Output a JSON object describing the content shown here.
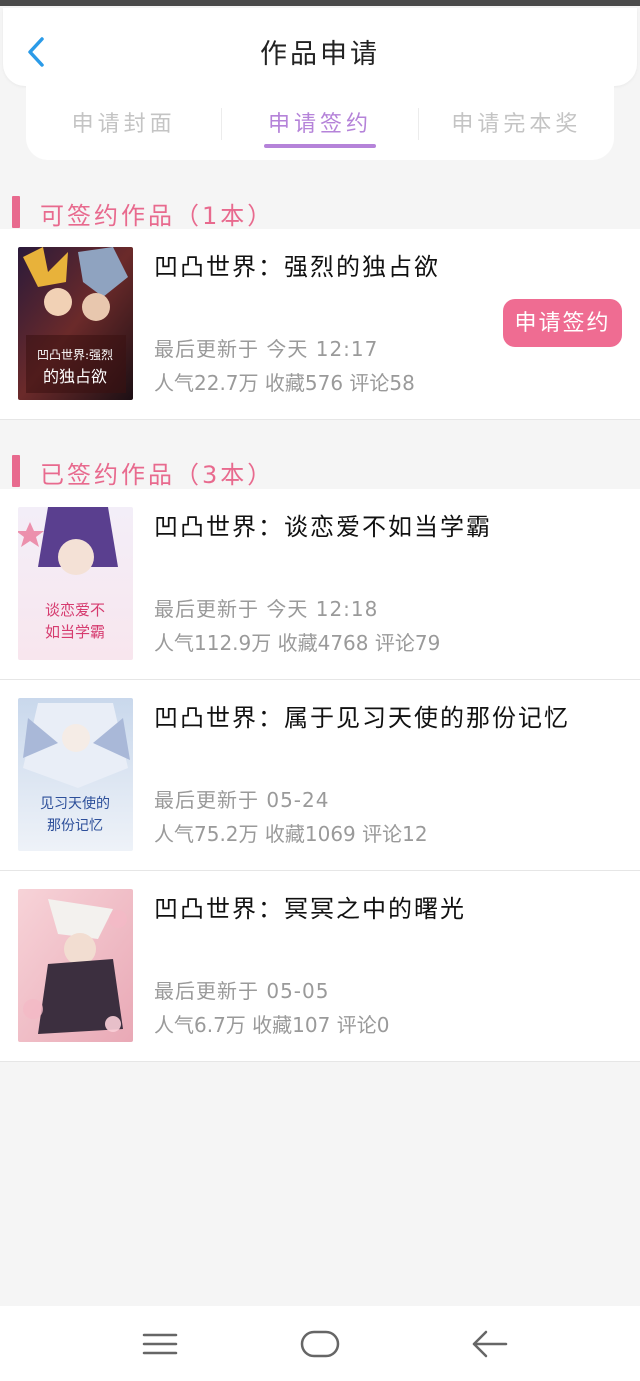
{
  "header": {
    "title": "作品申请"
  },
  "tabs": [
    {
      "label": "申请封面",
      "active": false
    },
    {
      "label": "申请签约",
      "active": true
    },
    {
      "label": "申请完本奖",
      "active": false
    }
  ],
  "signable_section": {
    "title": "可签约作品（1本）",
    "books": [
      {
        "title": "凹凸世界：强烈的独占欲",
        "updated": "最后更新于 今天 12:17",
        "stats": "人气22.7万 收藏576 评论58",
        "cover_text": "凹凸世界:强烈的独占欲",
        "apply_label": "申请签约"
      }
    ]
  },
  "signed_section": {
    "title": "已签约作品（3本）",
    "books": [
      {
        "title": "凹凸世界：谈恋爱不如当学霸",
        "updated": "最后更新于 今天 12:18",
        "stats": "人气112.9万 收藏4768 评论79",
        "cover_text": "谈恋爱不如当学霸"
      },
      {
        "title": "凹凸世界：属于见习天使的那份记忆",
        "updated": "最后更新于 05-24",
        "stats": "人气75.2万 收藏1069 评论12",
        "cover_text": "见习天使的那份记忆"
      },
      {
        "title": "凹凸世界：冥冥之中的曙光",
        "updated": "最后更新于 05-05",
        "stats": "人气6.7万 收藏107 评论0",
        "cover_text": ""
      }
    ]
  },
  "colors": {
    "accent_pink": "#ef6c92",
    "section_pink": "#e86a8e",
    "tab_active": "#b583d9",
    "back_blue": "#2b9be8"
  },
  "icons": {
    "back": "chevron-left-icon",
    "nav_menu": "menu-icon",
    "nav_home": "home-icon",
    "nav_back": "back-arrow-icon"
  }
}
